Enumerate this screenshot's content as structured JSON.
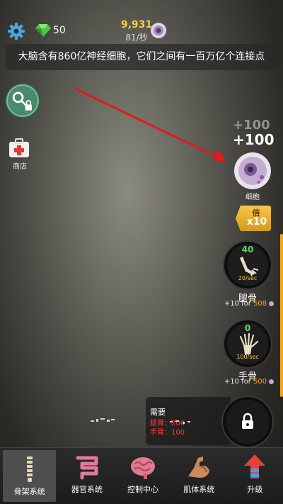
{
  "top": {
    "gem_count": "50",
    "currency_value": "9,931",
    "currency_rate": "81/秒"
  },
  "fact": "大脑含有860亿神经细胞，它们之间有一百万亿个连接点",
  "left": {
    "shop_label": "商店"
  },
  "right": {
    "float_plus_faded": "+100",
    "float_plus": "+100",
    "cell_label": "细胞",
    "multiplier_top": "倍",
    "multiplier_value": "x10",
    "items": [
      {
        "count": "40",
        "rate": "20/sec",
        "name": "腿骨",
        "cost_prefix": "+10 for",
        "cost": "508"
      },
      {
        "count": "0",
        "rate": "100/sec",
        "name": "手骨",
        "cost_prefix": "+10 for",
        "cost": "500"
      }
    ]
  },
  "requirement": {
    "title": "需要",
    "lines": [
      "腿骨：200",
      "手骨：100"
    ]
  },
  "nav": [
    {
      "label": "骨架系统",
      "icon": "spine-icon",
      "active": true
    },
    {
      "label": "器官系统",
      "icon": "intestine-icon",
      "active": false
    },
    {
      "label": "控制中心",
      "icon": "brain-icon",
      "active": false
    },
    {
      "label": "肌体系统",
      "icon": "muscle-arm-icon",
      "active": false
    },
    {
      "label": "升级",
      "icon": "upgrade-arrow-icon",
      "active": false
    }
  ],
  "colors": {
    "gold": "#f2c94c",
    "green": "#58d65a",
    "orange": "#f2a71e",
    "red": "#ff3b30"
  }
}
